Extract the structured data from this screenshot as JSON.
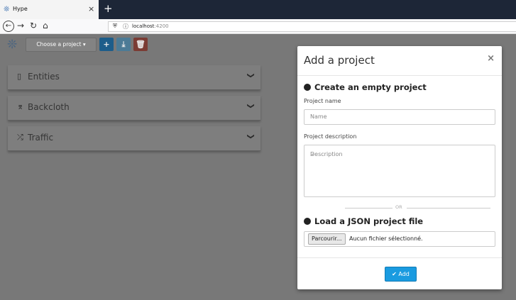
{
  "browser": {
    "tab_title": "Hype",
    "tab_close": "×",
    "new_tab": "+",
    "url_host": "localhost",
    "url_port": ":4200"
  },
  "toolbar": {
    "project_select": "Choose a project",
    "add_icon": "+",
    "download_icon": "⤓",
    "delete_icon": "🗑"
  },
  "panels": [
    {
      "label": "Entities",
      "icon": "▯"
    },
    {
      "label": "Backcloth",
      "icon": "⌆"
    },
    {
      "label": "Traffic",
      "icon": "⤮"
    }
  ],
  "modal": {
    "title": "Add a project",
    "close": "×",
    "section_empty": "Create an empty project",
    "name_label": "Project name",
    "name_placeholder": "Name",
    "desc_label": "Project description",
    "desc_placeholder": "Description",
    "separator": "OR",
    "section_json": "Load a JSON project file",
    "file_button": "Parcourir...",
    "file_status": "Aucun fichier sélectionné.",
    "add_button": "✔ Add"
  },
  "colors": {
    "accent": "#1a9be0",
    "topbar": "#1d2637"
  }
}
